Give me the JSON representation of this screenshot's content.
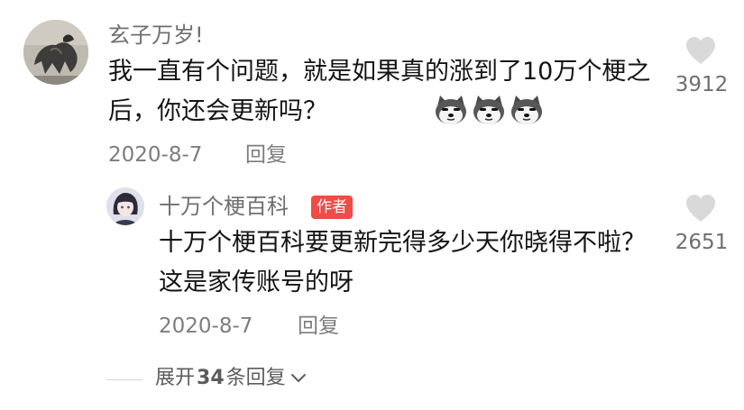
{
  "comment": {
    "username": "玄子万岁!",
    "text": "我一直有个问题，就是如果真的涨到了10万个梗之后，你还会更新吗？",
    "emojis": [
      "husky-emoji",
      "husky-emoji",
      "husky-emoji"
    ],
    "date": "2020-8-7",
    "reply_label": "回复",
    "likes": "3912"
  },
  "reply": {
    "username": "十万个梗百科",
    "badge": "作者",
    "text": "十万个梗百科要更新完得多少天你晓得不啦？这是家传账号的呀",
    "date": "2020-8-7",
    "reply_label": "回复",
    "likes": "2651"
  },
  "expand": {
    "prefix": "展开",
    "count": "34",
    "suffix": "条回复"
  },
  "colors": {
    "badge": "#f04b46",
    "heart": "#d9d9d9",
    "text": "#141414",
    "meta": "#7d7d7d"
  }
}
